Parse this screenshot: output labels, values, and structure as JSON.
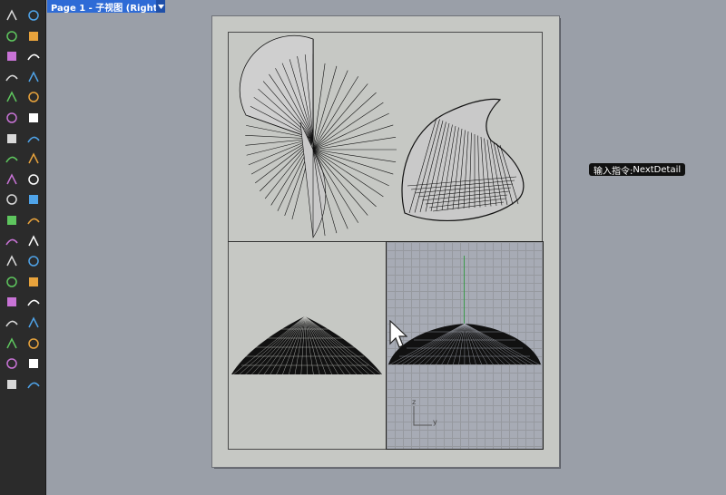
{
  "tab": {
    "label": "Page 1 - 子视图 (Right)"
  },
  "command_tip": {
    "prefix": "输入指令:",
    "command": "NextDetail"
  },
  "viewport": {
    "axis_z": "z",
    "axis_y": "y"
  },
  "colors": {
    "tab_bg": "#2e6bd6",
    "toolbar_bg": "#2b2b2b",
    "page_bg": "#c6c8c4",
    "detail_bg": "#a7abb5"
  },
  "toolbar": {
    "rows": [
      [
        "select-arrow-icon",
        "point-icon"
      ],
      [
        "polyline-icon",
        "curve-frame-icon"
      ],
      [
        "circle-icon",
        "ellipse-icon"
      ],
      [
        "polygon-icon",
        "rectangle-icon"
      ],
      [
        "hexagon-icon",
        "arc-curve-icon"
      ],
      [
        "transform-icon",
        "rotate-icon"
      ],
      [
        "box-solid-icon",
        "capsule-solid-icon"
      ],
      [
        "cylinder-icon",
        "surface-pink-icon"
      ],
      [
        "mesh-cross-icon",
        "explode-icon"
      ],
      [
        "analyze-icon",
        "measure-icon"
      ],
      [
        "boolean-icon",
        "split-icon"
      ],
      [
        "curve-edit-icon",
        "dimension-icon"
      ],
      [
        "text-icon",
        "hatch-icon"
      ],
      [
        "align-icon",
        "sphere-icon"
      ],
      [
        "scale-icon",
        "array-icon"
      ],
      [
        "flow-icon",
        "cube-green-icon"
      ],
      [
        "grid-icon",
        "layer-icon"
      ],
      [
        "render-icon",
        "check-icon"
      ],
      [
        "shade-icon",
        "materials-icon"
      ]
    ]
  }
}
